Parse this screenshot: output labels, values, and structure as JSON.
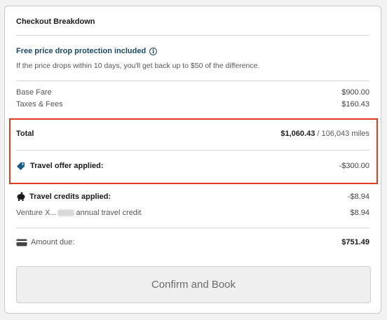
{
  "breakdown": {
    "title": "Checkout Breakdown",
    "promo_title": "Free price drop protection included",
    "promo_desc": "If the price drops within 10 days, you'll get back up to $50 of the difference.",
    "base_fare_label": "Base Fare",
    "base_fare_value": "$900.00",
    "taxes_label": "Taxes & Fees",
    "taxes_value": "$160.43",
    "total_label": "Total",
    "total_value": "$1,060.43",
    "total_miles": "/ 106,043 miles",
    "offer_label": "Travel offer applied:",
    "offer_value": "-$300.00",
    "credits_label": "Travel credits applied:",
    "credits_value": "-$8.94",
    "venture_prefix": "Venture X...",
    "venture_suffix": "annual travel credit",
    "venture_value": "$8.94",
    "amount_due_label": "Amount due:",
    "amount_due_value": "$751.49",
    "confirm_label": "Confirm and Book"
  },
  "colors": {
    "highlight_border": "#e23b22",
    "promo_text": "#1a4a66",
    "tag_icon": "#1a5a8a"
  },
  "icons": [
    "info-icon",
    "tag-icon",
    "piggy-bank-icon",
    "credit-card-icon"
  ]
}
